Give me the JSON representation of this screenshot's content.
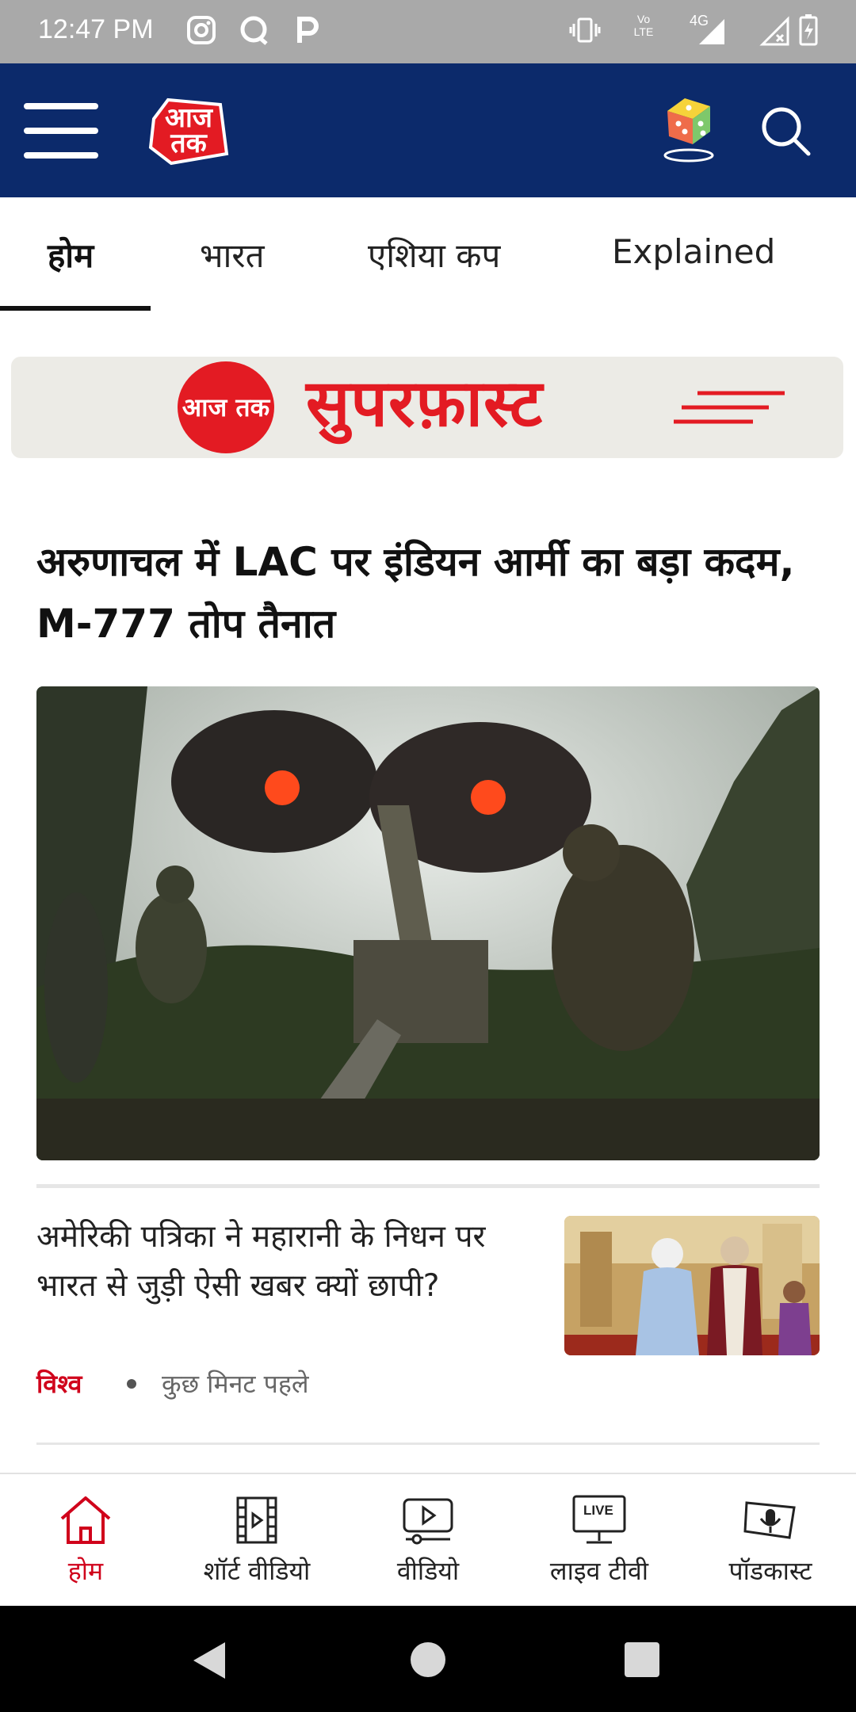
{
  "status_bar": {
    "time": "12:47 PM",
    "network_label": "4G",
    "volte_label": "Vo LTE"
  },
  "header": {
    "logo_text": "आज तक"
  },
  "tabs": [
    {
      "label": "होम",
      "active": true
    },
    {
      "label": "भारत",
      "active": false
    },
    {
      "label": "एशिया कप",
      "active": false
    },
    {
      "label": "Explained",
      "active": false
    }
  ],
  "banner": {
    "logo_text": "आज तक",
    "title": "सुपरफ़ास्ट"
  },
  "lead_story": {
    "title": "अरुणाचल में LAC पर इंडियन आर्मी का बड़ा कदम, M-777 तोप तैनात",
    "image": "artillery-firing-photo"
  },
  "stories": [
    {
      "title": "अमेरिकी पत्रिका ने महारानी के निधन पर भारत से जुड़ी ऐसी खबर क्यों छापी?",
      "category": "विश्व",
      "time": "कुछ मिनट पहले",
      "image": "queen-and-pm-photo"
    }
  ],
  "bottom_nav": [
    {
      "label": "होम",
      "icon": "home-icon",
      "active": true
    },
    {
      "label": "शॉर्ट वीडियो",
      "icon": "film-icon",
      "active": false
    },
    {
      "label": "वीडियो",
      "icon": "video-icon",
      "active": false
    },
    {
      "label": "लाइव टीवी",
      "icon": "live-tv-icon",
      "active": false,
      "icon_text": "LIVE"
    },
    {
      "label": "पॉडकास्ट",
      "icon": "podcast-icon",
      "active": false
    }
  ],
  "colors": {
    "header_bg": "#0c2a6b",
    "brand_red": "#e31b23",
    "category_red": "#d0021b"
  }
}
